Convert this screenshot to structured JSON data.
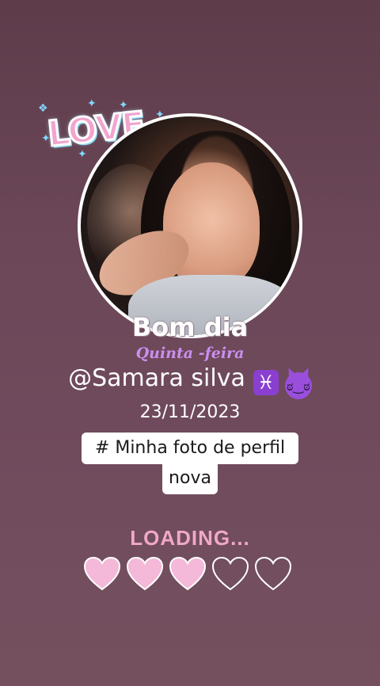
{
  "sticker": {
    "text": "LOVE"
  },
  "profile": {
    "greeting": "Bom dia",
    "weekday": "Quinta -feira",
    "username": "@Samara silva",
    "zodiac_symbol": "♓",
    "emoji_icon": "devil-face-icon"
  },
  "date": "23/11/2023",
  "caption": {
    "line1": "# Minha foto de perfil",
    "line2": "nova"
  },
  "loading": {
    "label": "LOADING...",
    "hearts_filled": 3,
    "hearts_total": 5,
    "fill_color": "#f4b8d8",
    "outline_color": "#ffffff"
  }
}
